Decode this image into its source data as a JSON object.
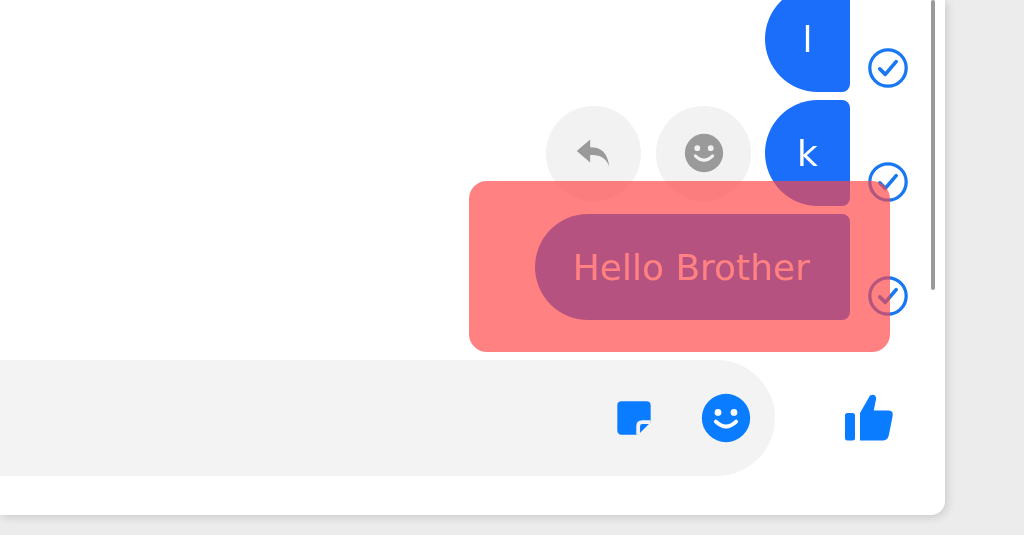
{
  "messages": [
    {
      "text": "l",
      "seen": true,
      "hovered": false,
      "highlighted": false
    },
    {
      "text": "k",
      "seen": true,
      "hovered": true,
      "highlighted": false
    },
    {
      "text": "Hello Brother",
      "seen": true,
      "hovered": false,
      "highlighted": true
    }
  ]
}
